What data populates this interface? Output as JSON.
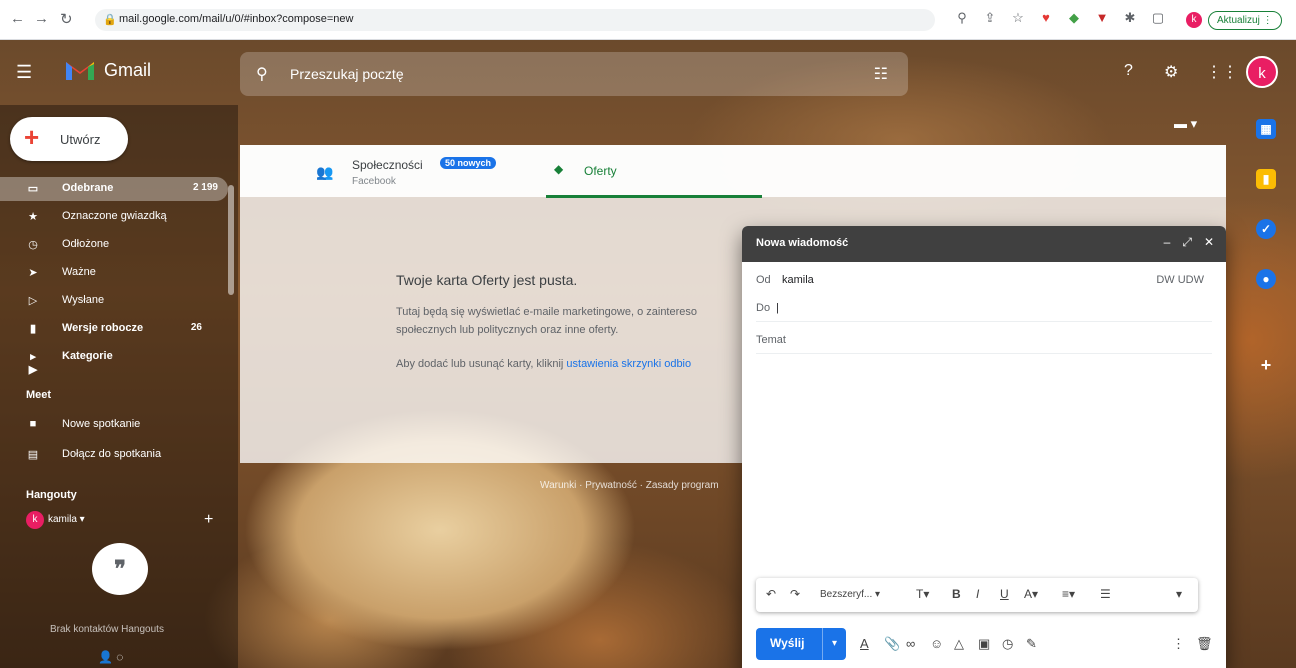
{
  "browser": {
    "url": "mail.google.com/mail/u/0/#inbox?compose=new",
    "update_label": "Aktualizuj",
    "profile_initial": "k"
  },
  "gmail": {
    "app_name": "Gmail",
    "search_placeholder": "Przeszukaj pocztę",
    "avatar_initial": "k"
  },
  "sidebar": {
    "compose_label": "Utwórz",
    "items": [
      {
        "label": "Odebrane",
        "count": "2 199",
        "icon": "inbox-icon"
      },
      {
        "label": "Oznaczone gwiazdką",
        "count": "",
        "icon": "star-icon"
      },
      {
        "label": "Odłożone",
        "count": "",
        "icon": "clock-icon"
      },
      {
        "label": "Ważne",
        "count": "",
        "icon": "important-icon"
      },
      {
        "label": "Wysłane",
        "count": "",
        "icon": "send-icon"
      },
      {
        "label": "Wersje robocze",
        "count": "26",
        "icon": "draft-icon"
      },
      {
        "label": "Kategorie",
        "count": "",
        "icon": "label-icon"
      }
    ],
    "meet_title": "Meet",
    "meet_items": [
      {
        "label": "Nowe spotkanie",
        "icon": "video-icon"
      },
      {
        "label": "Dołącz do spotkania",
        "icon": "keyboard-icon"
      }
    ],
    "hangouts_title": "Hangouty",
    "hangouts_user": "kamila",
    "hangouts_user_initial": "k",
    "no_contacts": "Brak kontaktów Hangouts"
  },
  "tabs": {
    "social_label": "Społeczności",
    "social_badge": "50 nowych",
    "social_sub": "Facebook",
    "offers_label": "Oferty"
  },
  "empty": {
    "title": "Twoje karta Oferty jest pusta.",
    "desc1": "Tutaj będą się wyświetlać e-maile marketingowe, o zaintereso",
    "desc2": "społecznych lub politycznych oraz inne oferty.",
    "hint_prefix": "Aby dodać lub usunąć karty, kliknij ",
    "hint_link": "ustawienia skrzynki odbio"
  },
  "footer": {
    "text": "Warunki · Prywatność · Zasady program"
  },
  "compose": {
    "title": "Nowa wiadomość",
    "from_key": "Od",
    "from_value": "kamila",
    "cc_label": "DW UDW",
    "to_key": "Do",
    "subject_placeholder": "Temat",
    "font_label": "Bezszeryf...",
    "send_label": "Wyślij"
  },
  "colors": {
    "accent": "#1a73e8",
    "offers_green": "#188038",
    "avatar_pink": "#e91e63"
  }
}
